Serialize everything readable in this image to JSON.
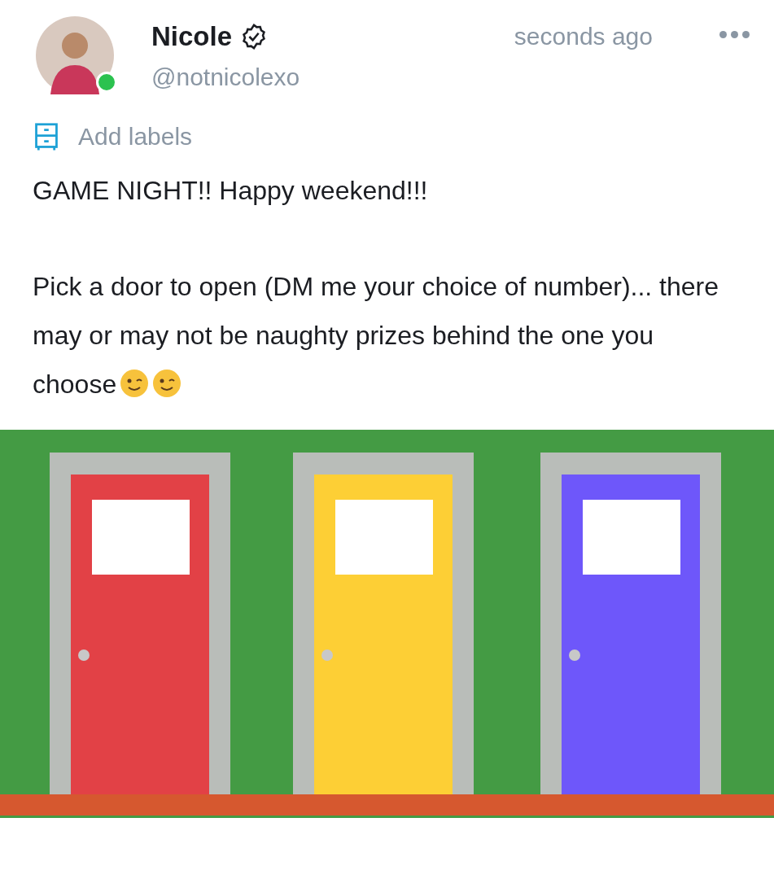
{
  "post": {
    "author": {
      "name": "Nicole",
      "verified": true,
      "handle": "@notnicolexo",
      "online": true
    },
    "time": "seconds ago",
    "labels_action": "Add labels",
    "paragraphs": [
      "GAME NIGHT!! Happy weekend!!!",
      "Pick a door to open (DM me your choice of number)... there may or may not be naughty prizes behind the one you choose"
    ]
  }
}
